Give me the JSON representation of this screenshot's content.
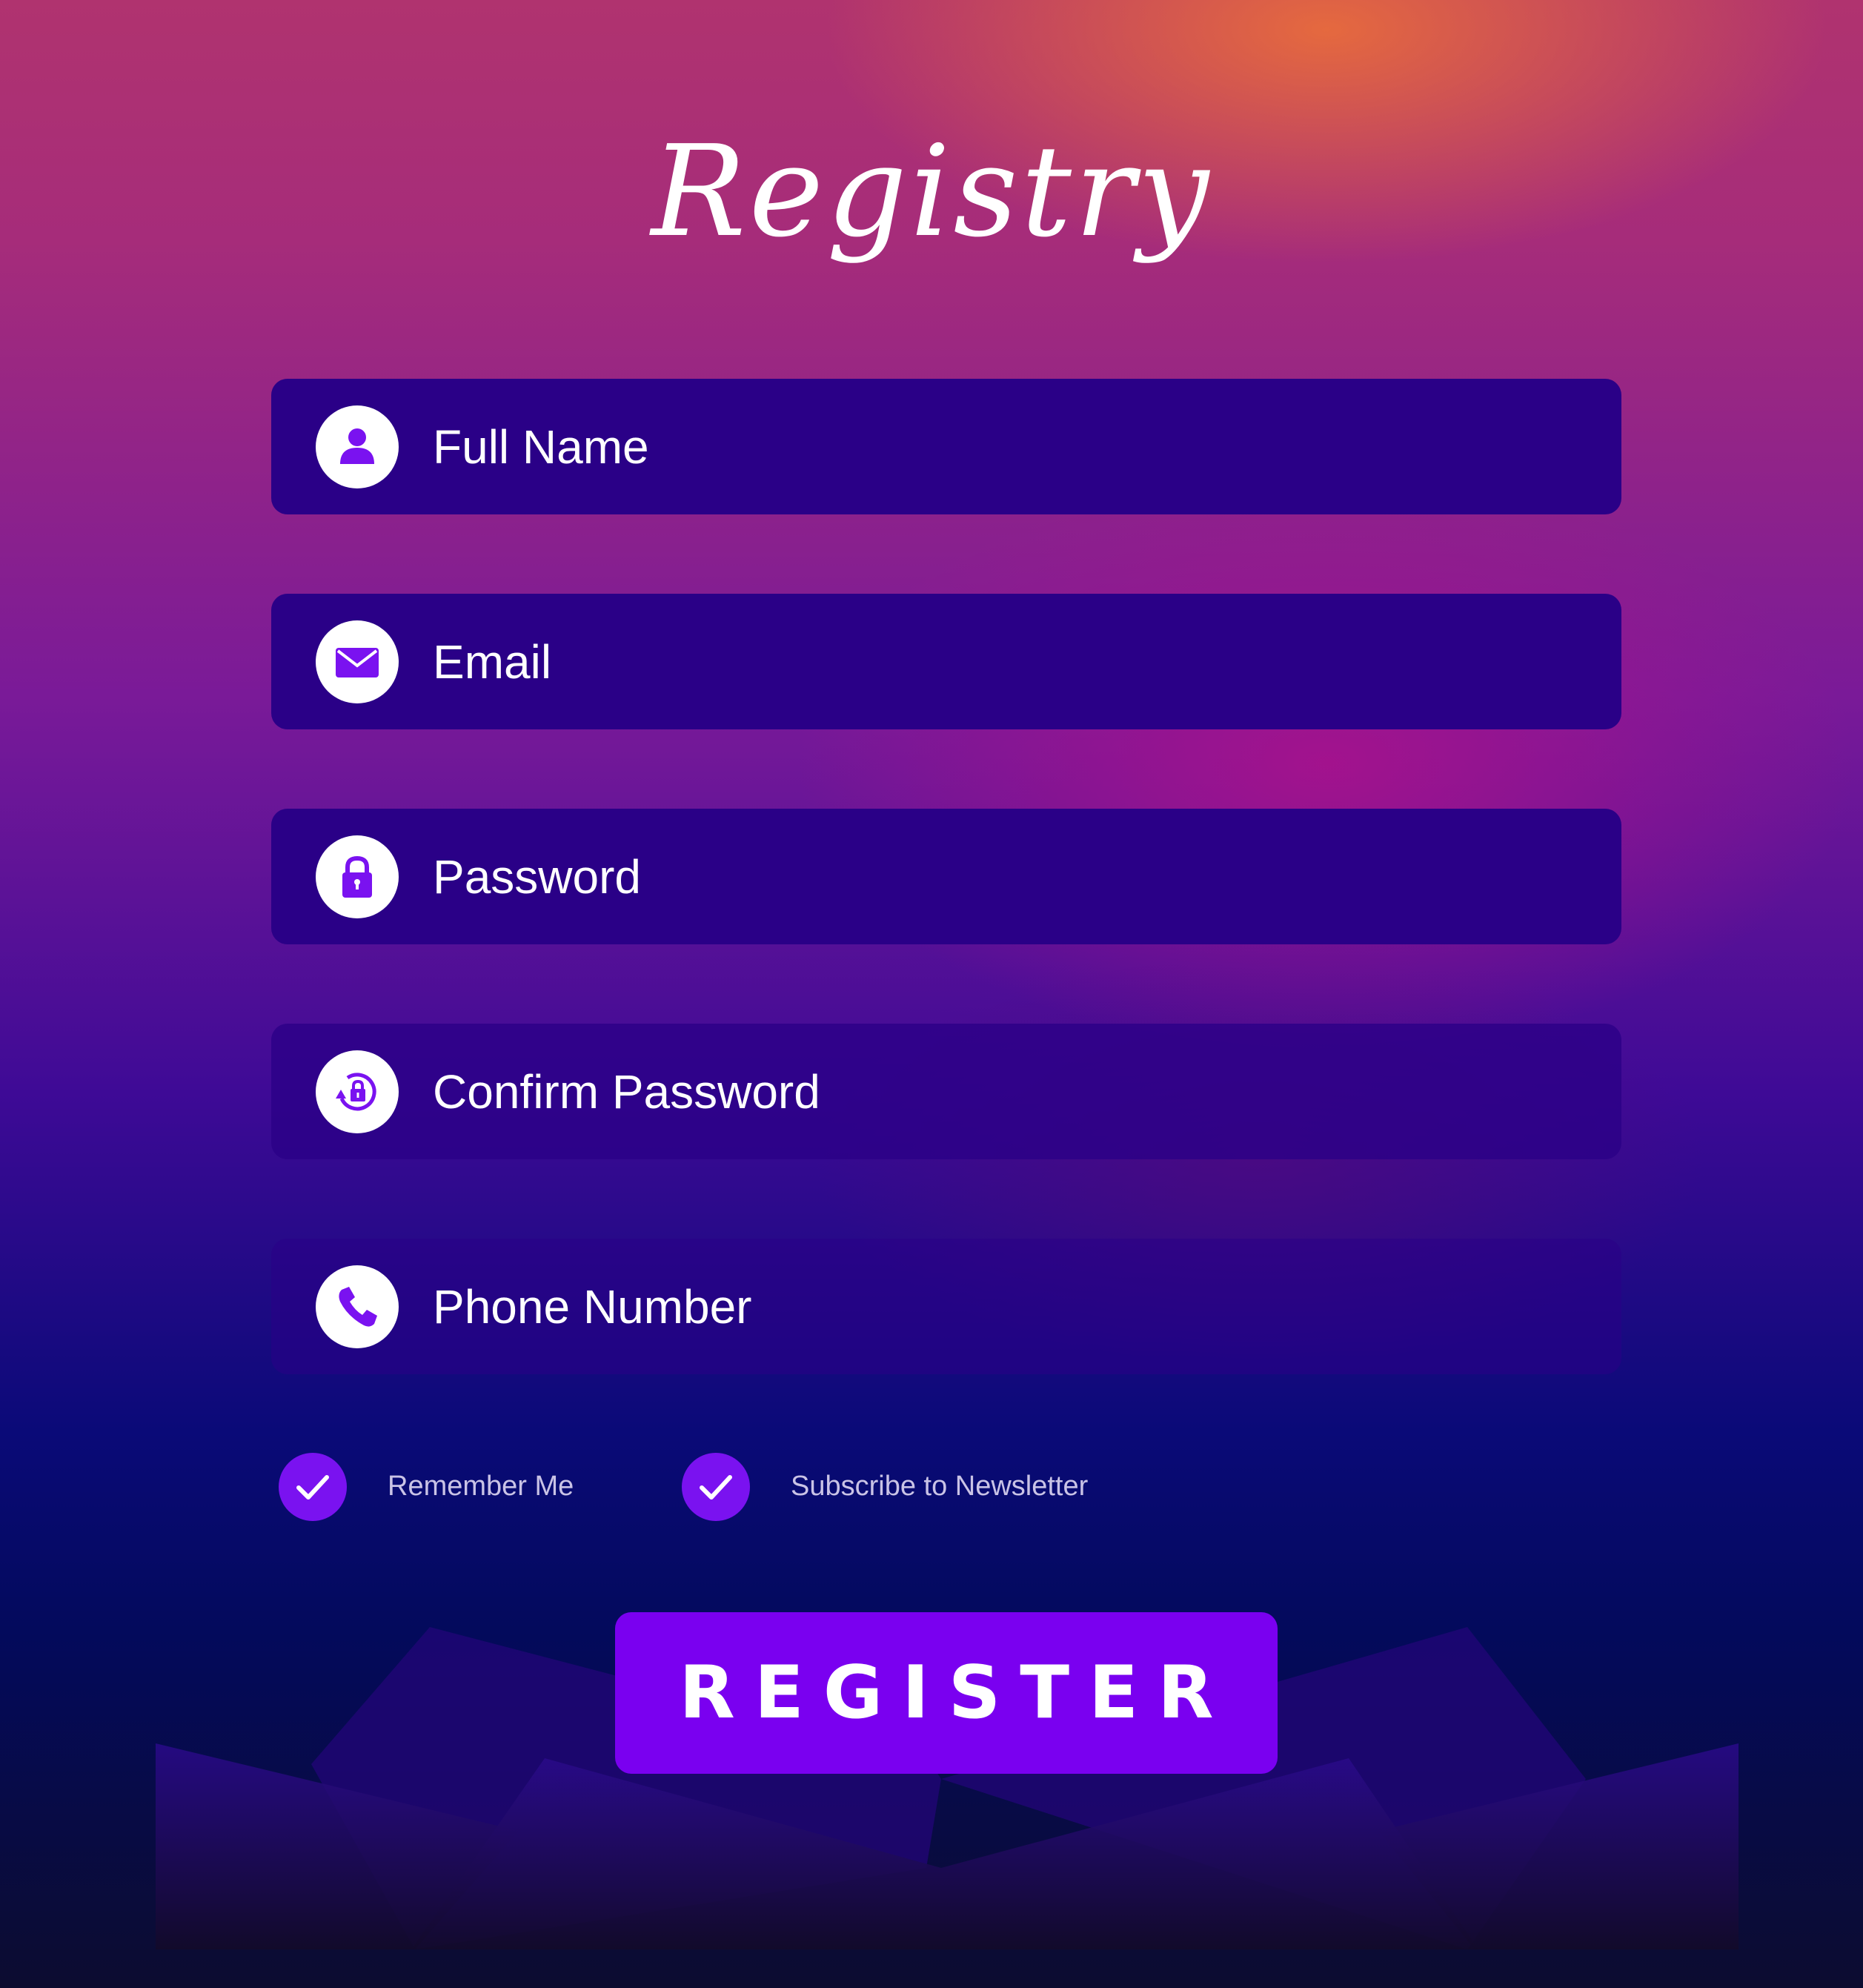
{
  "title": "Registry",
  "fields": [
    {
      "placeholder": "Full Name",
      "icon": "user-icon"
    },
    {
      "placeholder": "Email",
      "icon": "envelope-icon"
    },
    {
      "placeholder": "Password",
      "icon": "lock-icon"
    },
    {
      "placeholder": "Confirm Password",
      "icon": "lock-refresh-icon"
    },
    {
      "placeholder": "Phone Number",
      "icon": "phone-icon"
    }
  ],
  "options": {
    "remember_label": "Remember Me",
    "remember_checked": true,
    "newsletter_label": "Subscribe to Newsletter",
    "newsletter_checked": true
  },
  "register_label": "REGISTER",
  "colors": {
    "field_bg": "#2a0087",
    "accent": "#7a00f0",
    "icon_fill": "#7a12f0",
    "text": "#ffffff",
    "checkbox_label": "#c9c3e6"
  }
}
